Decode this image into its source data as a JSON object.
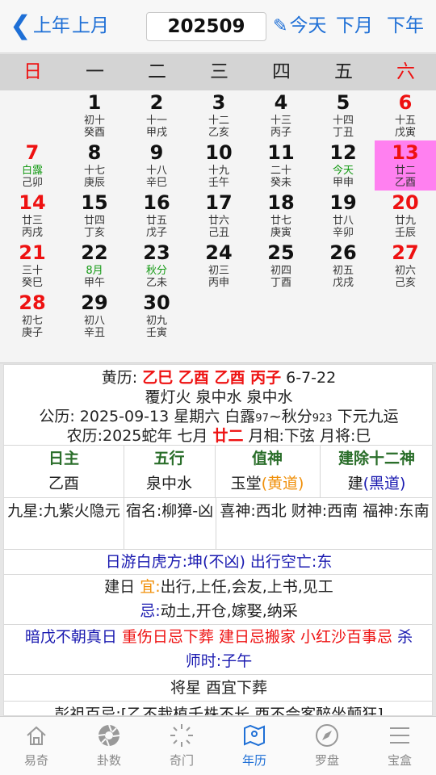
{
  "nav": {
    "prev_year": "上年",
    "prev_month": "上月",
    "month": "202509",
    "today": "今天",
    "next_month": "下月",
    "next_year": "下年"
  },
  "weekdays": [
    "日",
    "一",
    "二",
    "三",
    "四",
    "五",
    "六"
  ],
  "calendar": [
    {
      "d": "1",
      "s1": "初十",
      "s2": "癸酉"
    },
    {
      "d": "2",
      "s1": "十一",
      "s2": "甲戌"
    },
    {
      "d": "3",
      "s1": "十二",
      "s2": "乙亥"
    },
    {
      "d": "4",
      "s1": "十三",
      "s2": "丙子"
    },
    {
      "d": "5",
      "s1": "十四",
      "s2": "丁丑"
    },
    {
      "d": "6",
      "s1": "十五",
      "s2": "戊寅"
    },
    {
      "d": "7",
      "s1": "白露",
      "s2": "己卯"
    },
    {
      "d": "8",
      "s1": "十七",
      "s2": "庚辰"
    },
    {
      "d": "9",
      "s1": "十八",
      "s2": "辛巳"
    },
    {
      "d": "10",
      "s1": "十九",
      "s2": "壬午"
    },
    {
      "d": "11",
      "s1": "二十",
      "s2": "癸未"
    },
    {
      "d": "12",
      "s1": "今天",
      "s2": "甲申"
    },
    {
      "d": "13",
      "s1": "廿二",
      "s2": "乙酉"
    },
    {
      "d": "14",
      "s1": "廿三",
      "s2": "丙戌"
    },
    {
      "d": "15",
      "s1": "廿四",
      "s2": "丁亥"
    },
    {
      "d": "16",
      "s1": "廿五",
      "s2": "戊子"
    },
    {
      "d": "17",
      "s1": "廿六",
      "s2": "己丑"
    },
    {
      "d": "18",
      "s1": "廿七",
      "s2": "庚寅"
    },
    {
      "d": "19",
      "s1": "廿八",
      "s2": "辛卯"
    },
    {
      "d": "20",
      "s1": "廿九",
      "s2": "壬辰"
    },
    {
      "d": "21",
      "s1": "三十",
      "s2": "癸巳"
    },
    {
      "d": "22",
      "s1": "8月",
      "s2": "甲午"
    },
    {
      "d": "23",
      "s1": "秋分",
      "s2": "乙未"
    },
    {
      "d": "24",
      "s1": "初三",
      "s2": "丙申"
    },
    {
      "d": "25",
      "s1": "初四",
      "s2": "丁酉"
    },
    {
      "d": "26",
      "s1": "初五",
      "s2": "戊戌"
    },
    {
      "d": "27",
      "s1": "初六",
      "s2": "己亥"
    },
    {
      "d": "28",
      "s1": "初七",
      "s2": "庚子"
    },
    {
      "d": "29",
      "s1": "初八",
      "s2": "辛丑"
    },
    {
      "d": "30",
      "s1": "初九",
      "s2": "壬寅"
    }
  ],
  "detail": {
    "huangli_label": "黄历:",
    "huangli_ganzhi": "乙巳 乙酉 乙酉 丙子",
    "huangli_num": "6-7-22",
    "nayin": "覆灯火 泉中水 泉中水",
    "gongli_label": "公历:",
    "gongli_date": "2025-09-13 星期六 白露",
    "gongli_t1": "97",
    "gongli_mid": "~秋分",
    "gongli_t2": "923",
    "gongli_tail": "下元九运",
    "nongli_label": "农历:",
    "nongli_date": "2025蛇年 七月",
    "nongli_day": "廿二",
    "nongli_tail": "月相:下弦 月将:巳",
    "shen_headers": [
      "日主",
      "五行",
      "值神",
      "建除十二神"
    ],
    "shen_values": {
      "rizhu": "乙酉",
      "wuxing": "泉中水",
      "zhishen": "玉堂",
      "zhishen_tag": "(黄道)",
      "jianchu": "建",
      "jianchu_tag": "(黑道)"
    },
    "jiuxing": "九星:九紫火隐元",
    "suming": "宿名:柳獐-凶",
    "caishen": "喜神:西北 财神:西南 福神:东南",
    "riyou": "日游白虎方:坤(不凶) 出行空亡:东",
    "yi_prefix": "建日",
    "yi_label": "宜:",
    "yi_text": "出行,上任,会友,上书,见工",
    "ji_label": "忌:",
    "ji_text": "动土,开仓,嫁娶,纳采",
    "anwu": "暗戊不朝真日",
    "chongshang": "重伤日忌下葬",
    "jianri_ban": "建日忌搬家",
    "xiaohong": "小红沙百事忌",
    "sha_label": "杀",
    "shashi": "师时:子午",
    "jiangxing": "将星 酉宜下葬",
    "pengzu": "彭祖百忌:[乙不栽植千株不长 酉不会客醉坐颠狂]"
  },
  "tabs": [
    {
      "label": "易奇",
      "icon": "house-icon"
    },
    {
      "label": "卦数",
      "icon": "aperture-icon"
    },
    {
      "label": "奇门",
      "icon": "sunburst-icon"
    },
    {
      "label": "年历",
      "icon": "map-icon"
    },
    {
      "label": "罗盘",
      "icon": "compass-icon"
    },
    {
      "label": "宝盒",
      "icon": "menu-icon"
    }
  ],
  "colors": {
    "accent": "#1e6fd6",
    "red": "#e11111",
    "today_highlight": "#ff80f0",
    "green": "#149a14"
  }
}
